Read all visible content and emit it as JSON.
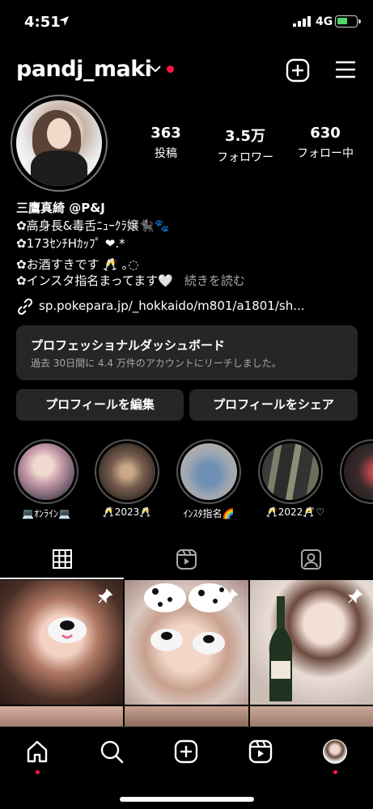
{
  "status_bar": {
    "time": "4:51",
    "network": "4G"
  },
  "header": {
    "username": "pandj_maki"
  },
  "stats": [
    {
      "value": "363",
      "label": "投稿"
    },
    {
      "value": "3.5万",
      "label": "フォロワー"
    },
    {
      "value": "630",
      "label": "フォロー中"
    }
  ],
  "bio": {
    "name": "三鷹真綺 @P&J",
    "lines": [
      "✿高身長&毒舌ﾆｭｰｸﾗ嬢🐈‍⬛🐾",
      "✿173ｾﾝﾁHｶｯﾌﾟ ❤︎.*",
      "✿お酒すきです 🥂 ｡◌",
      "✿インスタ指名まってます🤍"
    ],
    "more": "続きを読む",
    "link": "sp.pokepara.jp/_hokkaido/m801/a1801/sh..."
  },
  "dashboard": {
    "title": "プロフェッショナルダッシュボード",
    "subtitle": "過去 30日間に 4.4 万件のアカウントにリーチしました。"
  },
  "buttons": {
    "edit": "プロフィールを編集",
    "share": "プロフィールをシェア"
  },
  "highlights": [
    {
      "label": "💻ｵﾝﾗｲﾝ💻"
    },
    {
      "label": "🥂2023🥂"
    },
    {
      "label": "ｲﾝｽﾀ指名🌈"
    },
    {
      "label": "🥂2022🥂"
    },
    {
      "label": "-`♡"
    }
  ],
  "tabs": [
    {
      "name": "grid-icon"
    },
    {
      "name": "reels-icon"
    },
    {
      "name": "tagged-icon"
    }
  ],
  "nav": [
    {
      "name": "home-icon"
    },
    {
      "name": "search-icon"
    },
    {
      "name": "create-icon"
    },
    {
      "name": "reels-icon"
    },
    {
      "name": "profile-avatar"
    }
  ],
  "colors": {
    "accent_red": "#ff1744",
    "card_bg": "#262626",
    "muted": "#a8a8a8"
  }
}
